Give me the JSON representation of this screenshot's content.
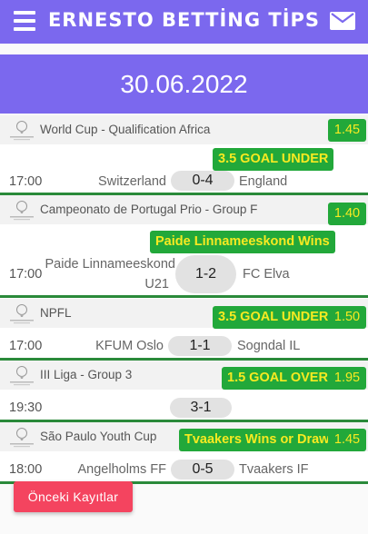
{
  "app": {
    "title": "ERNESTO BETTİNG TİPS"
  },
  "date": "30.06.2022",
  "matches": [
    {
      "league": "World Cup - Qualification Africa",
      "tip": "3.5 GOAL UNDER",
      "odds": "1.45",
      "time": "17:00",
      "home": "Switzerland",
      "score": "0-4",
      "away": "England"
    },
    {
      "league": "Campeonato de Portugal Prio - Group F",
      "tip": "Paide Linnameeskond Wins",
      "odds": "1.40",
      "time": "17:00",
      "home_line1": "Paide Linnameeskond",
      "home_line2": "U21",
      "score": "1-2",
      "away": "FC Elva"
    },
    {
      "league": "NPFL",
      "tip": "3.5 GOAL UNDER",
      "odds": "1.50",
      "time": "17:00",
      "home": "KFUM Oslo",
      "score": "1-1",
      "away": "Sogndal IL"
    },
    {
      "league": "III Liga - Group 3",
      "tip": "1.5 GOAL OVER",
      "odds": "1.95",
      "time": "19:30",
      "home": "",
      "score": "3-1",
      "away": ""
    },
    {
      "league": "São Paulo Youth Cup",
      "tip": "Tvaakers Wins or Draw",
      "odds": "1.45",
      "time": "18:00",
      "home": "Angelholms FF",
      "score": "0-5",
      "away": "Tvaakers IF"
    }
  ],
  "buttons": {
    "previous": "Önceki Kayıtlar"
  },
  "colors": {
    "primary": "#7b68ee",
    "tip_bg": "#22a83a",
    "tip_text": "#f7ea21",
    "divider": "#2a8a3a",
    "previous_button": "#f4445f"
  },
  "icons": {
    "menu": "hamburger-menu-icon",
    "mail": "envelope-icon",
    "league": "league-logo"
  }
}
